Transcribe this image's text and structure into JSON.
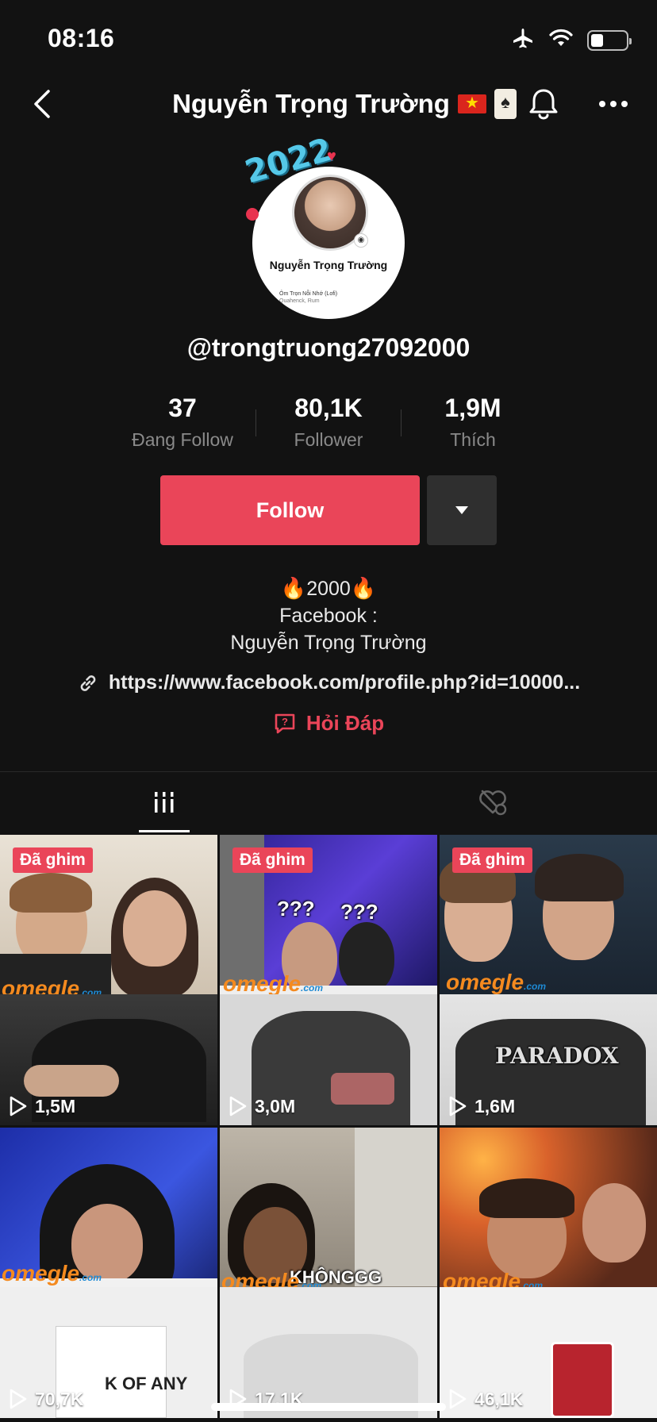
{
  "status_bar": {
    "time": "08:16",
    "battery_level": 0.35,
    "icons": [
      "airplane-icon",
      "wifi-icon",
      "battery-icon"
    ]
  },
  "nav": {
    "title": "Nguyễn Trọng Trường",
    "icons": [
      "back-icon",
      "flag-vn-icon",
      "card-icon",
      "bell-icon",
      "more-icon"
    ]
  },
  "avatar": {
    "frame_year": "2022",
    "card_name": "Nguyễn Trọng Trường",
    "card_song": "Ôm Trọn Nỗi Nhớ (Lofi)",
    "card_artist": "Quahenck, Rum"
  },
  "profile": {
    "username": "@trongtruong27092000"
  },
  "stats": [
    {
      "value": "37",
      "label": "Đang Follow"
    },
    {
      "value": "80,1K",
      "label": "Follower"
    },
    {
      "value": "1,9M",
      "label": "Thích"
    }
  ],
  "actions": {
    "follow_label": "Follow"
  },
  "bio": {
    "line1": "2000",
    "line2": "Facebook :",
    "line3": "Nguyễn Trọng Trường"
  },
  "link": {
    "text": "https://www.facebook.com/profile.php?id=10000..."
  },
  "qa": {
    "label": "Hỏi Đáp"
  },
  "tabs": [
    {
      "name": "videos-tab",
      "icon": "grid-icon",
      "active": true
    },
    {
      "name": "liked-tab",
      "icon": "hidden-heart-icon",
      "active": false
    }
  ],
  "videos": [
    {
      "pinned_label": "Đã ghim",
      "views": "1,5M"
    },
    {
      "pinned_label": "Đã ghim",
      "views": "3,0M",
      "caption_a": "???",
      "caption_b": "???"
    },
    {
      "pinned_label": "Đã ghim",
      "views": "1,6M",
      "shirt_text": "PARADOX"
    },
    {
      "pinned_label": "",
      "views": "70,7K",
      "card_text": "K OF ANY"
    },
    {
      "pinned_label": "",
      "views": "17,1K",
      "caption": "KHÔNGGG"
    },
    {
      "pinned_label": "",
      "views": "46,1K"
    }
  ],
  "watermark": {
    "text": "omegle",
    "suffix": ".com"
  },
  "colors": {
    "accent": "#ea4559",
    "background": "#121212",
    "secondary_text": "#8a8a8a"
  }
}
